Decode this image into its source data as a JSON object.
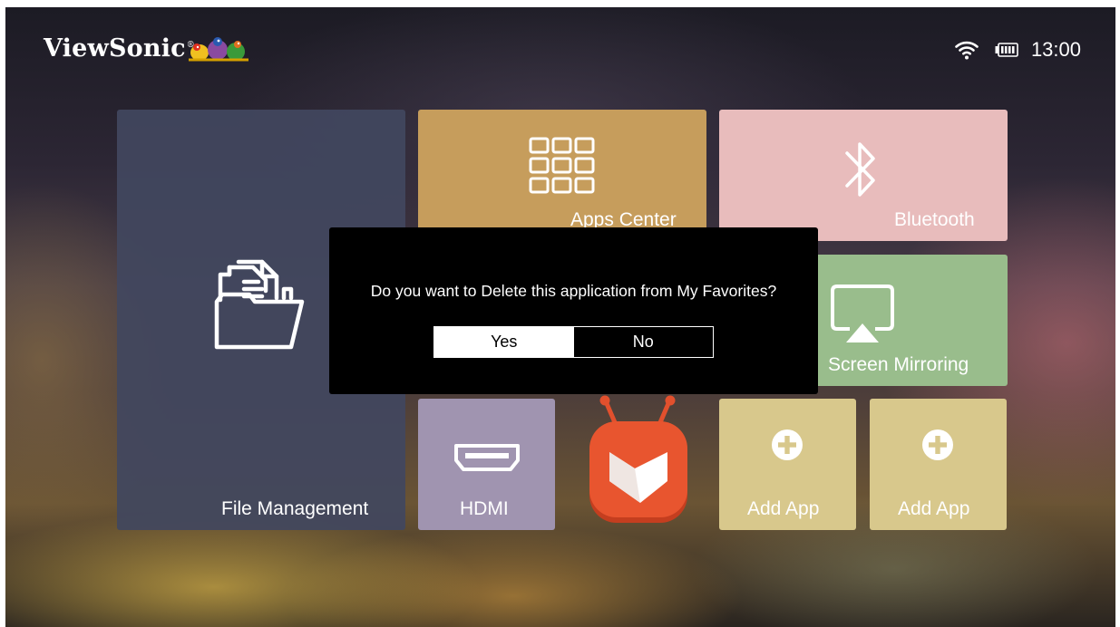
{
  "brand": {
    "name": "ViewSonic",
    "mark": "®"
  },
  "status_bar": {
    "icons": [
      "wifi-icon",
      "battery-icon"
    ],
    "time": "13:00"
  },
  "tiles": {
    "file_management": {
      "label": "File Management",
      "icon": "folder-documents-icon",
      "color": "#42475f"
    },
    "apps_center": {
      "label": "Apps Center",
      "icon": "app-grid-icon",
      "color": "#c69d5c"
    },
    "bluetooth": {
      "label": "Bluetooth",
      "icon": "bluetooth-icon",
      "color": "#e8bcbc"
    },
    "screen_mirroring": {
      "label": "Screen Mirroring",
      "icon": "screen-mirroring-icon",
      "color": "#99bd8c"
    },
    "hdmi": {
      "label": "HDMI",
      "icon": "hdmi-icon",
      "color": "#a094b0"
    },
    "aptoide": {
      "icon": "aptoide-tv-icon",
      "color": "#e2502d"
    },
    "add_app_1": {
      "label": "Add App",
      "icon": "plus-circle-icon",
      "color": "#d8c88c"
    },
    "add_app_2": {
      "label": "Add App",
      "icon": "plus-circle-icon",
      "color": "#d8c88c"
    }
  },
  "dialog": {
    "message": "Do you want to Delete this application from My Favorites?",
    "yes_label": "Yes",
    "no_label": "No",
    "selected": "Yes"
  }
}
